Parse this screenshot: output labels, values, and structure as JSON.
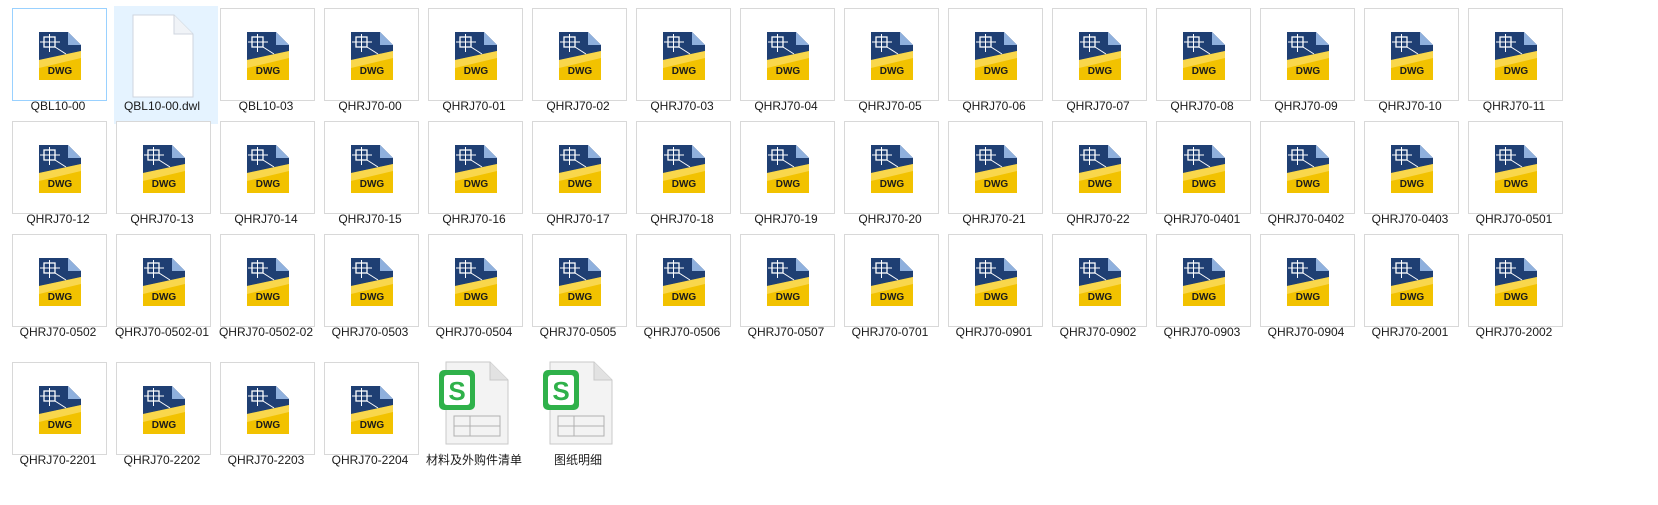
{
  "files": [
    {
      "name": "QBL10-00",
      "type": "dwg",
      "selected": true
    },
    {
      "name": "QBL10-00.dwl",
      "type": "blank",
      "highlight": true
    },
    {
      "name": "QBL10-03",
      "type": "dwg"
    },
    {
      "name": "QHRJ70-00",
      "type": "dwg"
    },
    {
      "name": "QHRJ70-01",
      "type": "dwg"
    },
    {
      "name": "QHRJ70-02",
      "type": "dwg"
    },
    {
      "name": "QHRJ70-03",
      "type": "dwg"
    },
    {
      "name": "QHRJ70-04",
      "type": "dwg"
    },
    {
      "name": "QHRJ70-05",
      "type": "dwg"
    },
    {
      "name": "QHRJ70-06",
      "type": "dwg"
    },
    {
      "name": "QHRJ70-07",
      "type": "dwg"
    },
    {
      "name": "QHRJ70-08",
      "type": "dwg"
    },
    {
      "name": "QHRJ70-09",
      "type": "dwg"
    },
    {
      "name": "QHRJ70-10",
      "type": "dwg"
    },
    {
      "name": "QHRJ70-11",
      "type": "dwg"
    },
    {
      "name": "QHRJ70-12",
      "type": "dwg"
    },
    {
      "name": "QHRJ70-13",
      "type": "dwg"
    },
    {
      "name": "QHRJ70-14",
      "type": "dwg"
    },
    {
      "name": "QHRJ70-15",
      "type": "dwg"
    },
    {
      "name": "QHRJ70-16",
      "type": "dwg"
    },
    {
      "name": "QHRJ70-17",
      "type": "dwg"
    },
    {
      "name": "QHRJ70-18",
      "type": "dwg"
    },
    {
      "name": "QHRJ70-19",
      "type": "dwg"
    },
    {
      "name": "QHRJ70-20",
      "type": "dwg"
    },
    {
      "name": "QHRJ70-21",
      "type": "dwg"
    },
    {
      "name": "QHRJ70-22",
      "type": "dwg"
    },
    {
      "name": "QHRJ70-0401",
      "type": "dwg"
    },
    {
      "name": "QHRJ70-0402",
      "type": "dwg"
    },
    {
      "name": "QHRJ70-0403",
      "type": "dwg"
    },
    {
      "name": "QHRJ70-0501",
      "type": "dwg"
    },
    {
      "name": "QHRJ70-0502",
      "type": "dwg"
    },
    {
      "name": "QHRJ70-0502-01",
      "type": "dwg"
    },
    {
      "name": "QHRJ70-0502-02",
      "type": "dwg"
    },
    {
      "name": "QHRJ70-0503",
      "type": "dwg"
    },
    {
      "name": "QHRJ70-0504",
      "type": "dwg"
    },
    {
      "name": "QHRJ70-0505",
      "type": "dwg"
    },
    {
      "name": "QHRJ70-0506",
      "type": "dwg"
    },
    {
      "name": "QHRJ70-0507",
      "type": "dwg"
    },
    {
      "name": "QHRJ70-0701",
      "type": "dwg"
    },
    {
      "name": "QHRJ70-0901",
      "type": "dwg"
    },
    {
      "name": "QHRJ70-0902",
      "type": "dwg"
    },
    {
      "name": "QHRJ70-0903",
      "type": "dwg"
    },
    {
      "name": "QHRJ70-0904",
      "type": "dwg"
    },
    {
      "name": "QHRJ70-2001",
      "type": "dwg"
    },
    {
      "name": "QHRJ70-2002",
      "type": "dwg"
    },
    {
      "name": "QHRJ70-2201",
      "type": "dwg"
    },
    {
      "name": "QHRJ70-2202",
      "type": "dwg"
    },
    {
      "name": "QHRJ70-2203",
      "type": "dwg"
    },
    {
      "name": "QHRJ70-2204",
      "type": "dwg"
    },
    {
      "name": "材料及外购件清单",
      "type": "spreadsheet"
    },
    {
      "name": "图纸明细",
      "type": "spreadsheet"
    }
  ],
  "icons": {
    "dwg_badge_text": "DWG",
    "dwg_colors": {
      "navy": "#1f3f73",
      "gold": "#f2c200",
      "light": "#ffe98a"
    },
    "spreadsheet_badge_color": "#2fb14a"
  }
}
